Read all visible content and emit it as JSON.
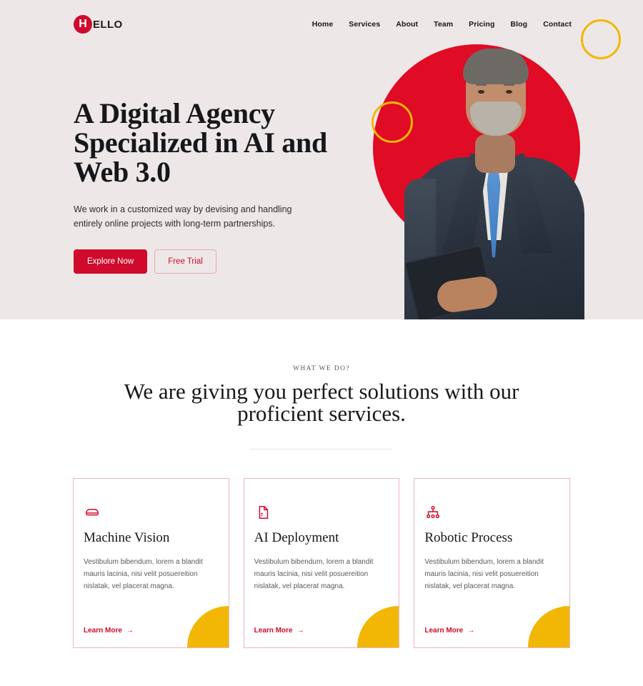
{
  "brand": {
    "mark_letter": "H",
    "name": "ELLO",
    "accent_red": "#cf0a2c",
    "hero_red": "#e00b24",
    "accent_yellow": "#f2b705",
    "hero_bg": "#ede8e7",
    "card_border": "#eab6c0"
  },
  "nav": {
    "items": [
      {
        "label": "Home"
      },
      {
        "label": "Services"
      },
      {
        "label": "About"
      },
      {
        "label": "Team"
      },
      {
        "label": "Pricing"
      },
      {
        "label": "Blog"
      },
      {
        "label": "Contact"
      }
    ]
  },
  "hero": {
    "title": "A Digital Agency Specialized in AI and Web 3.0",
    "subtitle": "We work in a customized way by devising and handling entirely online projects with long-term partnerships.",
    "primary_button": "Explore Now",
    "secondary_button": "Free Trial",
    "image_alt": "businessman-holding-tablet"
  },
  "services": {
    "eyebrow": "WHAT WE DO?",
    "title": "We are giving you perfect solutions with our proficient services.",
    "cards": [
      {
        "icon": "server-icon",
        "title": "Machine Vision",
        "text": "Vestibulum bibendum, lorem a blandit mauris lacinia, nisi velit posuereition nislatak, vel placerat magna.",
        "link": "Learn More",
        "arrow": "→"
      },
      {
        "icon": "document-icon",
        "title": "AI Deployment",
        "text": "Vestibulum bibendum, lorem a blandit mauris lacinia, nisi velit posuereition nislatak, vel placerat magna.",
        "link": "Learn More",
        "arrow": "→"
      },
      {
        "icon": "sitemap-icon",
        "title": "Robotic Process",
        "text": "Vestibulum bibendum, lorem a blandit mauris lacinia, nisi velit posuereition nislatak, vel placerat magna.",
        "link": "Learn More",
        "arrow": "→"
      }
    ]
  }
}
